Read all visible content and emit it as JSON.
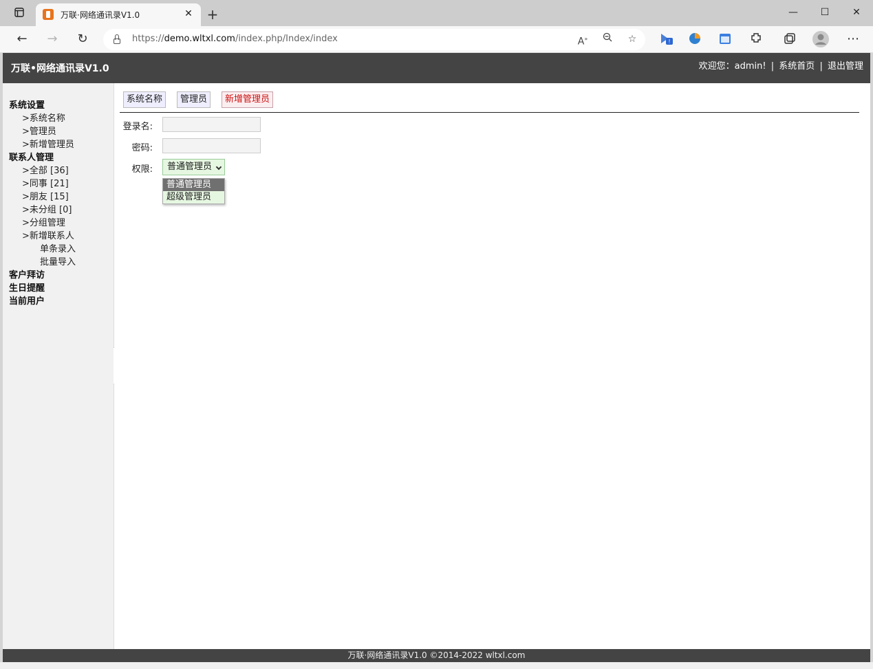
{
  "browser": {
    "tab_title": "万联·网络通讯录V1.0",
    "url_prefix": "https://",
    "url_domain": "demo.wltxl.com",
    "url_path": "/index.php/Index/index",
    "icons": [
      "tab-actions-icon",
      "back-icon",
      "forward-icon",
      "refresh-icon",
      "lock-icon",
      "read-aloud-icon",
      "zoom-out-icon",
      "favorite-icon",
      "extensions-icon",
      "collections-icon",
      "profile-icon",
      "more-icon"
    ]
  },
  "header": {
    "title": "万联•网络通讯录V1.0",
    "welcome": "欢迎您：admin!",
    "home_link": "系统首页",
    "logout_link": "退出管理",
    "separator": "|"
  },
  "sidebar": {
    "items": [
      {
        "label": "系统设置",
        "level": "group"
      },
      {
        "label": ">系统名称",
        "level": "l1"
      },
      {
        "label": ">管理员",
        "level": "l1"
      },
      {
        "label": ">新增管理员",
        "level": "l1"
      },
      {
        "label": "联系人管理",
        "level": "group"
      },
      {
        "label": ">全部 [36]",
        "level": "l1"
      },
      {
        "label": ">同事 [21]",
        "level": "l1"
      },
      {
        "label": ">朋友 [15]",
        "level": "l1"
      },
      {
        "label": ">未分组 [0]",
        "level": "l1"
      },
      {
        "label": ">分组管理",
        "level": "l1"
      },
      {
        "label": ">新增联系人",
        "level": "l1"
      },
      {
        "label": "单条录入",
        "level": "l2"
      },
      {
        "label": "批量导入",
        "level": "l2"
      },
      {
        "label": "客户拜访",
        "level": "group"
      },
      {
        "label": "生日提醒",
        "level": "group"
      },
      {
        "label": "当前用户",
        "level": "group"
      }
    ]
  },
  "main": {
    "tabs": [
      {
        "label": "系统名称",
        "active": false
      },
      {
        "label": "管理员",
        "active": false
      },
      {
        "label": "新增管理员",
        "active": true
      }
    ],
    "form": {
      "login_label": "登录名:",
      "login_value": "",
      "password_label": "密码:",
      "password_value": "",
      "role_label": "权限:",
      "role_selected": "普通管理员",
      "role_options": [
        "普通管理员",
        "超级管理员"
      ]
    }
  },
  "footer": {
    "text": "万联·网络通讯录V1.0 ©2014-2022 wltxl.com"
  }
}
